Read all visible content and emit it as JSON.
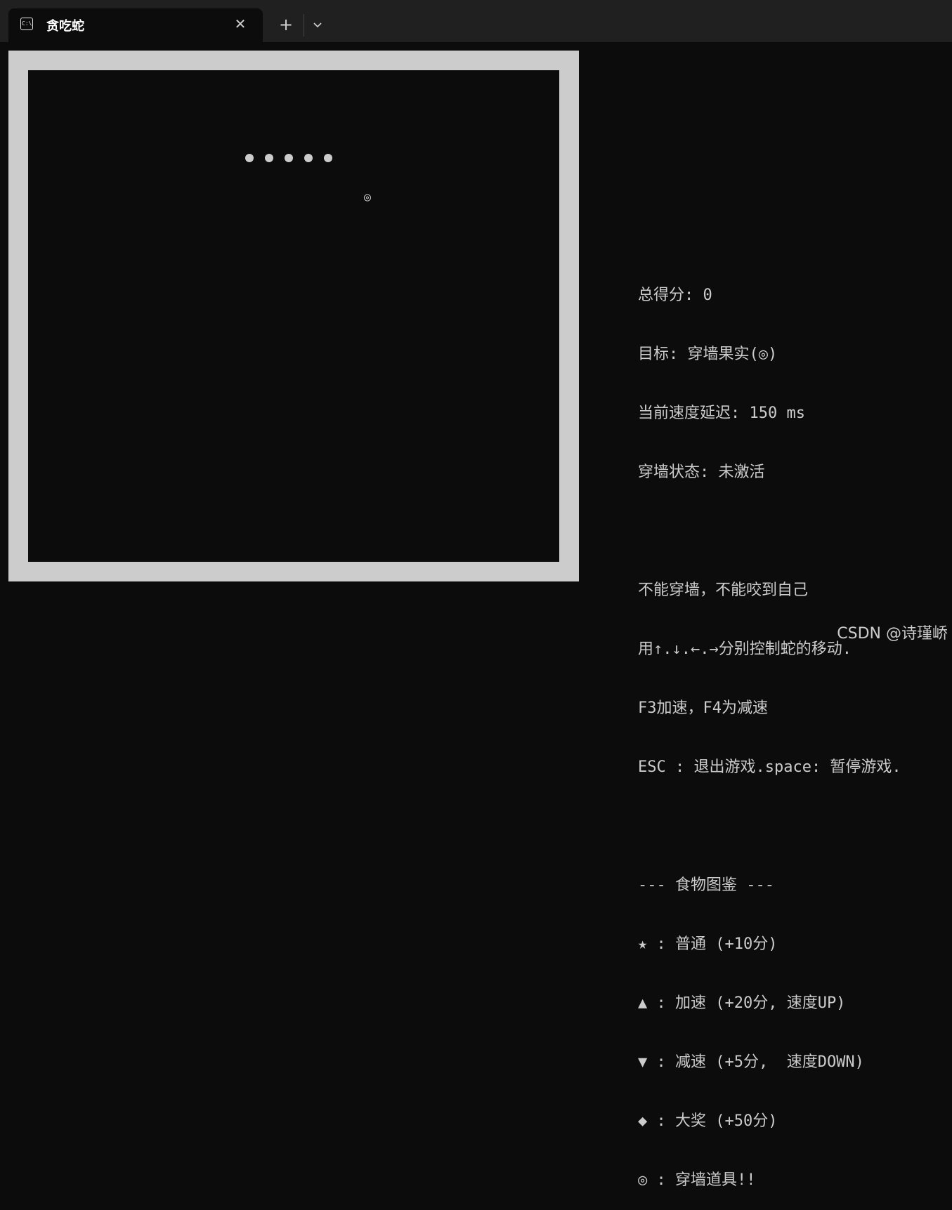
{
  "window": {
    "tab_title": "贪吃蛇",
    "tab_icon": "terminal-icon",
    "close_glyph": "✕",
    "new_tab_glyph": "+"
  },
  "game": {
    "snake_segments": 5,
    "food_glyph": "◎",
    "wall_color": "#cccccc",
    "background_color": "#0c0c0c"
  },
  "panel": {
    "score": "总得分: 0",
    "goal": "目标: 穿墙果实(◎)",
    "speed": "当前速度延迟: 150 ms",
    "wall_state": "穿墙状态: 未激活",
    "rule1": "不能穿墙，不能咬到自己",
    "rule2": "用↑.↓.←.→分别控制蛇的移动.",
    "rule3": "F3加速，F4为减速",
    "rule4": "ESC : 退出游戏.space: 暂停游戏.",
    "legend_title": "--- 食物图鉴 ---",
    "legend": [
      "★ : 普通 (+10分)",
      "▲ : 加速 (+20分, 速度UP)",
      "▼ : 减速 (+5分,  速度DOWN)",
      "◆ : 大奖 (+50分)",
      "◎ : 穿墙道具!!"
    ]
  },
  "watermark": "CSDN @诗瑾峤"
}
